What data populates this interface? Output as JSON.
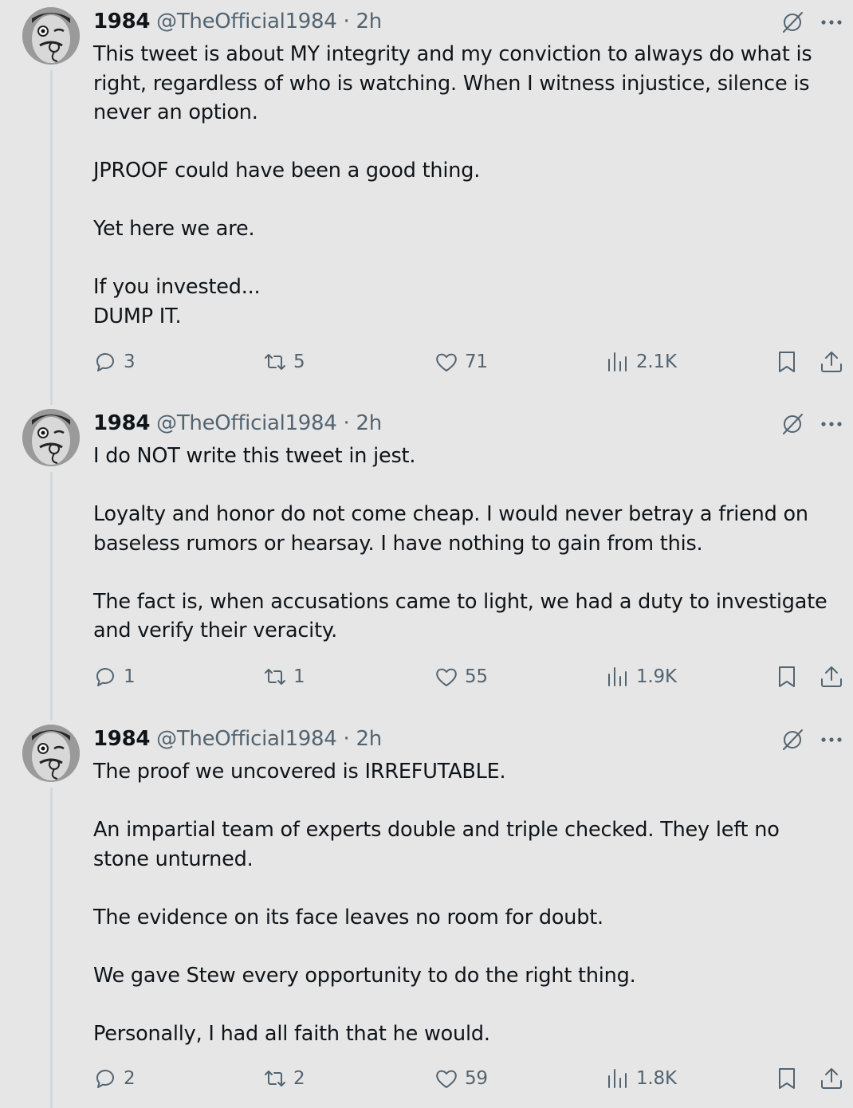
{
  "tweets": [
    {
      "author_name": "1984",
      "handle": "@TheOfficial1984",
      "separator": "·",
      "time": "2h",
      "text": "This tweet is about MY integrity and my conviction to always do what is right, regardless of who is watching. When I witness injustice, silence is never an option.\n\nJPROOF could have been a good thing.\n\nYet here we are.\n\nIf you invested...\nDUMP IT.",
      "replies": "3",
      "retweets": "5",
      "likes": "71",
      "views": "2.1K"
    },
    {
      "author_name": "1984",
      "handle": "@TheOfficial1984",
      "separator": "·",
      "time": "2h",
      "text": "I do NOT write this tweet in jest.\n\nLoyalty and honor do not come cheap. I would never betray a friend on baseless rumors or hearsay. I have nothing to gain from this.\n\nThe fact is, when accusations came to light, we had a duty to investigate and verify their veracity.",
      "replies": "1",
      "retweets": "1",
      "likes": "55",
      "views": "1.9K"
    },
    {
      "author_name": "1984",
      "handle": "@TheOfficial1984",
      "separator": "·",
      "time": "2h",
      "text": "The proof we uncovered is IRREFUTABLE.\n\nAn impartial team of experts double and triple checked. They left no stone unturned.\n\nThe evidence on its face leaves no room for doubt.\n\nWe gave Stew every opportunity to do the right thing.\n\nPersonally, I had all faith that he would.",
      "replies": "2",
      "retweets": "2",
      "likes": "59",
      "views": "1.8K"
    }
  ],
  "icons": {
    "grok": "grok-icon",
    "more": "more-icon",
    "reply": "reply-icon",
    "retweet": "retweet-icon",
    "like": "heart-icon",
    "views": "views-icon",
    "bookmark": "bookmark-icon",
    "share": "share-icon"
  },
  "colors": {
    "background": "#e6e6e6",
    "text": "#0f1419",
    "secondary": "#536471",
    "thread_line": "#cfd9de"
  }
}
